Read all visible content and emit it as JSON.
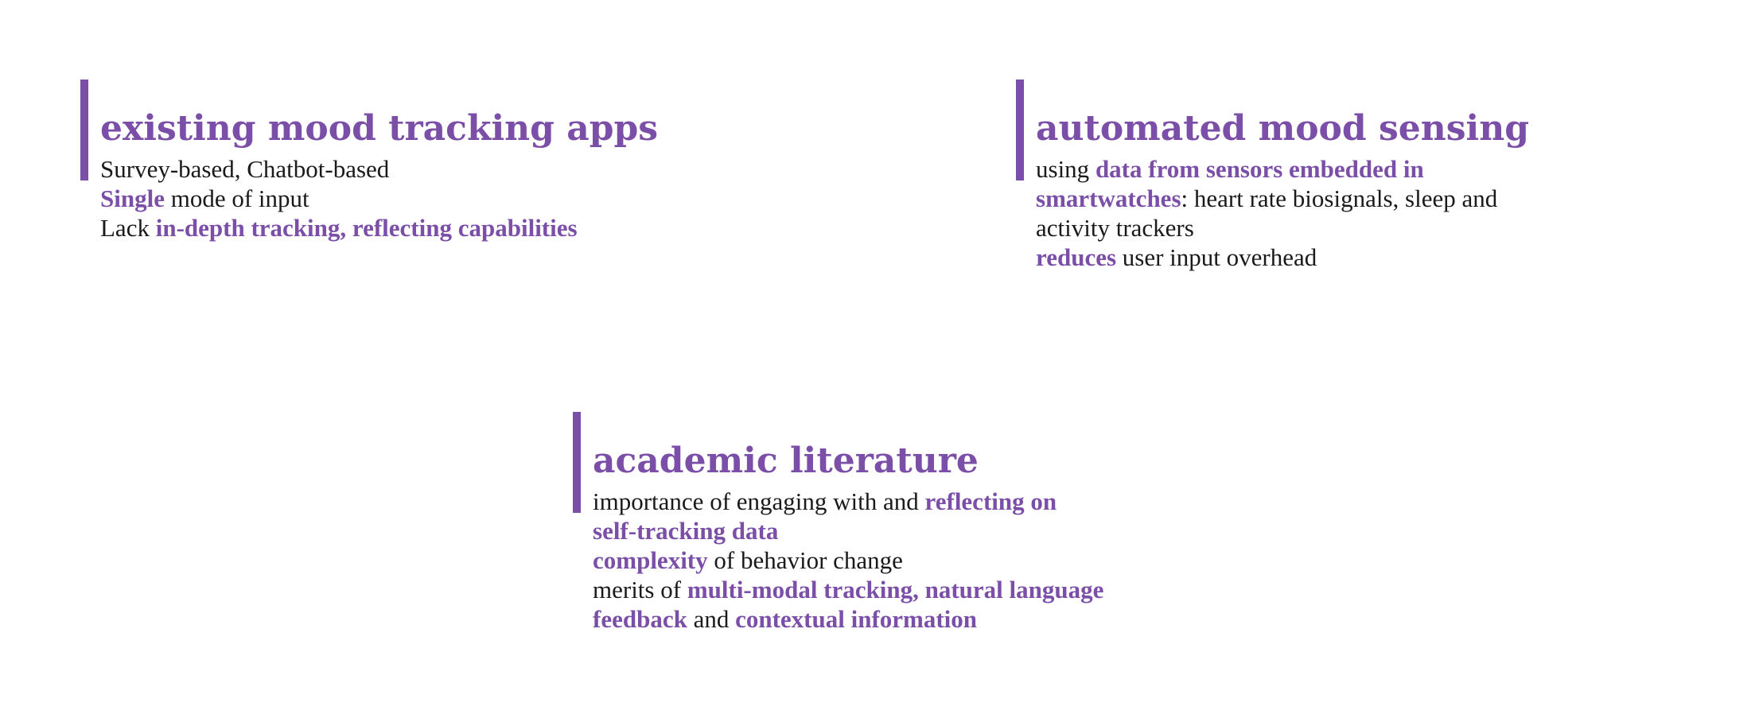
{
  "blocks": [
    {
      "title": "existing mood tracking apps",
      "lines": [
        [
          {
            "text": "Survey-based, Chatbot-based",
            "hl": false
          }
        ],
        [
          {
            "text": "Single",
            "hl": true
          },
          {
            "text": " mode of input",
            "hl": false
          }
        ],
        [
          {
            "text": "Lack ",
            "hl": false
          },
          {
            "text": "in-depth tracking, reflecting capabilities",
            "hl": true
          }
        ]
      ]
    },
    {
      "title": "automated mood sensing",
      "lines": [
        [
          {
            "text": "using ",
            "hl": false
          },
          {
            "text": "data from sensors embedded in",
            "hl": true
          }
        ],
        [
          {
            "text": "smartwatches",
            "hl": true
          },
          {
            "text": ": heart rate biosignals, sleep and",
            "hl": false
          }
        ],
        [
          {
            "text": "activity trackers",
            "hl": false
          }
        ],
        [
          {
            "text": "reduces",
            "hl": true
          },
          {
            "text": " user input overhead",
            "hl": false
          }
        ]
      ]
    },
    {
      "title": "academic literature",
      "lines": [
        [
          {
            "text": "importance of engaging with and ",
            "hl": false
          },
          {
            "text": "reflecting on",
            "hl": true
          }
        ],
        [
          {
            "text": "self-tracking data",
            "hl": true
          }
        ],
        [
          {
            "text": "complexity",
            "hl": true
          },
          {
            "text": " of behavior change",
            "hl": false
          }
        ],
        [
          {
            "text": "merits of ",
            "hl": false
          },
          {
            "text": "multi-modal tracking, natural language",
            "hl": true
          }
        ],
        [
          {
            "text": "feedback",
            "hl": true
          },
          {
            "text": " and ",
            "hl": false
          },
          {
            "text": "contextual information",
            "hl": true
          }
        ]
      ]
    }
  ],
  "colors": {
    "accent": "#7b4ea8",
    "text": "#1a1a1a",
    "background": "#ffffff"
  }
}
